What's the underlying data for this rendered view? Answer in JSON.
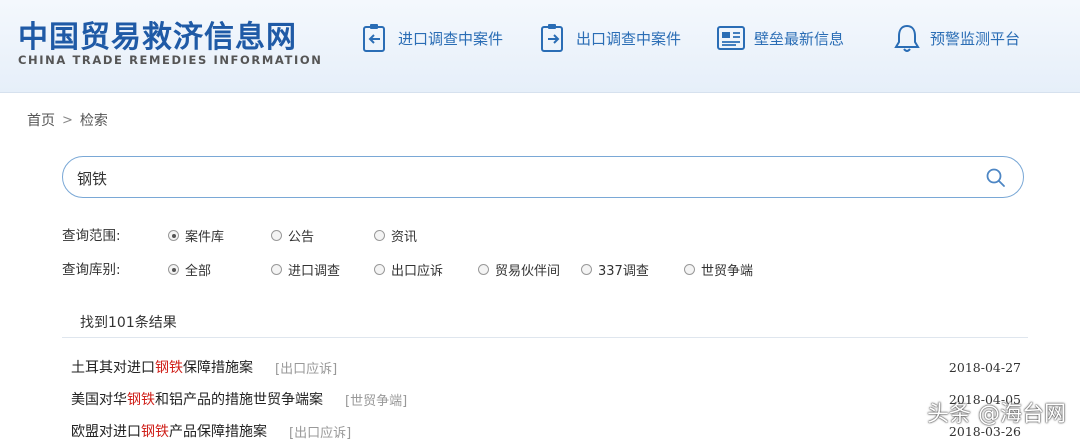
{
  "site": {
    "title_cn": "中国贸易救济信息网",
    "title_en": "CHINA TRADE REMEDIES INFORMATION"
  },
  "nav": [
    {
      "label": "进口调查中案件",
      "icon": "import-case-icon"
    },
    {
      "label": "出口调查中案件",
      "icon": "export-case-icon"
    },
    {
      "label": "壁垒最新信息",
      "icon": "news-icon"
    },
    {
      "label": "预警监测平台",
      "icon": "bell-icon"
    }
  ],
  "breadcrumb": {
    "home": "首页",
    "separator": ">",
    "current": "检索"
  },
  "search": {
    "value": "钢铁",
    "placeholder": ""
  },
  "filters": {
    "scope": {
      "label": "查询范围:",
      "options": [
        "案件库",
        "公告",
        "资讯"
      ],
      "selected": "案件库"
    },
    "library": {
      "label": "查询库别:",
      "options": [
        "全部",
        "进口调查",
        "出口应诉",
        "贸易伙伴间",
        "337调查",
        "世贸争端"
      ],
      "selected": "全部"
    }
  },
  "results": {
    "count_text": "找到101条结果",
    "items": [
      {
        "pre": "土耳其对进口",
        "hl": "钢铁",
        "post": "保障措施案",
        "tag": "[出口应诉]",
        "date": "2018-04-27"
      },
      {
        "pre": "美国对华",
        "hl": "钢铁",
        "post": "和铝产品的措施世贸争端案",
        "tag": "[世贸争端]",
        "date": "2018-04-05"
      },
      {
        "pre": "欧盟对进口",
        "hl": "钢铁",
        "post": "产品保障措施案",
        "tag": "[出口应诉]",
        "date": "2018-03-26"
      }
    ]
  },
  "watermark": "头条 @海台网",
  "colors": {
    "brand": "#1f5aa6",
    "nav": "#2a6db5",
    "highlight": "#d0201a",
    "search_border": "#7aa8d6"
  }
}
